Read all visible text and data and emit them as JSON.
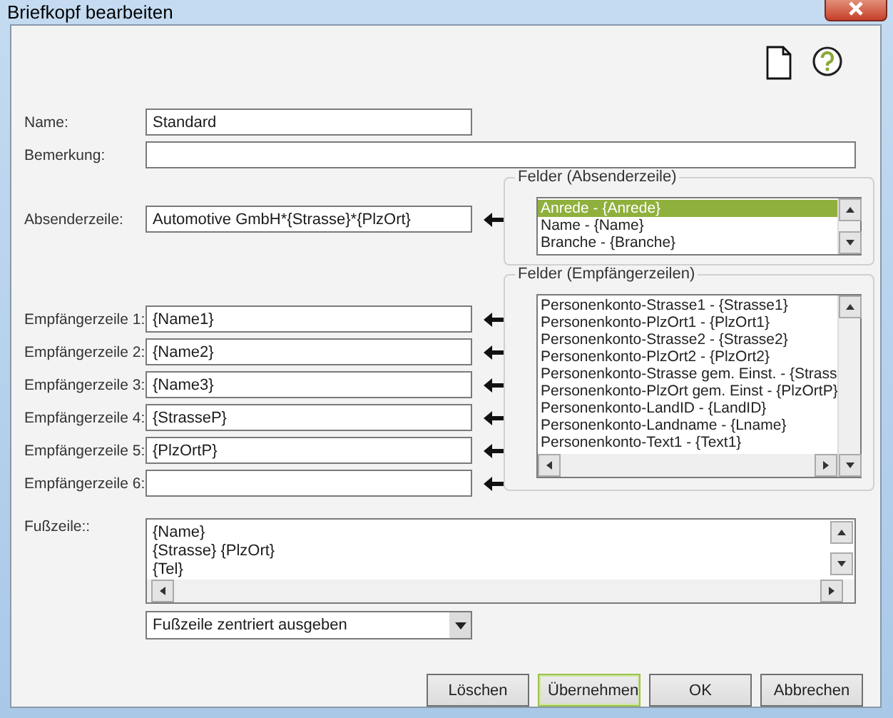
{
  "window": {
    "title": "Briefkopf bearbeiten"
  },
  "name": {
    "label": "Name:",
    "value": "Standard"
  },
  "remark": {
    "label": "Bemerkung:"
  },
  "sender": {
    "label": "Absenderzeile:",
    "value": "Automotive GmbH*{Strasse}*{PlzOrt}"
  },
  "recipients": [
    {
      "label": "Empfängerzeile 1:",
      "value": "{Name1}"
    },
    {
      "label": "Empfängerzeile 2:",
      "value": "{Name2}"
    },
    {
      "label": "Empfängerzeile 3:",
      "value": "{Name3}"
    },
    {
      "label": "Empfängerzeile 4:",
      "value": "{StrasseP}"
    },
    {
      "label": "Empfängerzeile 5:",
      "value": "{PlzOrtP}"
    },
    {
      "label": "Empfängerzeile 6:"
    }
  ],
  "sender_fields": {
    "title": "Felder (Absenderzeile)",
    "items": [
      {
        "text": "Anrede - {Anrede}",
        "selected": true
      },
      {
        "text": "Name - {Name}",
        "selected": false
      },
      {
        "text": "Branche - {Branche}",
        "selected": false
      }
    ]
  },
  "recipient_fields": {
    "title": "Felder (Empfängerzeilen)",
    "items": [
      {
        "text": "Personenkonto-Strasse1 - {Strasse1}",
        "selected": false
      },
      {
        "text": "Personenkonto-PlzOrt1 - {PlzOrt1}",
        "selected": false
      },
      {
        "text": "Personenkonto-Strasse2 - {Strasse2}",
        "selected": false
      },
      {
        "text": "Personenkonto-PlzOrt2 - {PlzOrt2}",
        "selected": false
      },
      {
        "text": "Personenkonto-Strasse gem. Einst. - {Strass",
        "selected": false
      },
      {
        "text": "Personenkonto-PlzOrt gem. Einst - {PlzOrtP}",
        "selected": false
      },
      {
        "text": "Personenkonto-LandID - {LandID}",
        "selected": false
      },
      {
        "text": "Personenkonto-Landname - {Lname}",
        "selected": false
      },
      {
        "text": "Personenkonto-Text1 - {Text1}",
        "selected": false
      }
    ]
  },
  "footer": {
    "label": "Fußzeile::",
    "lines": [
      "{Name}",
      "{Strasse} {PlzOrt}",
      "{Tel}"
    ],
    "alignment": "Fußzeile zentriert ausgeben"
  },
  "buttons": [
    {
      "label": "Löschen",
      "default": false
    },
    {
      "label": "Übernehmen",
      "default": true
    },
    {
      "label": "OK",
      "default": false
    },
    {
      "label": "Abbrechen",
      "default": false
    }
  ]
}
